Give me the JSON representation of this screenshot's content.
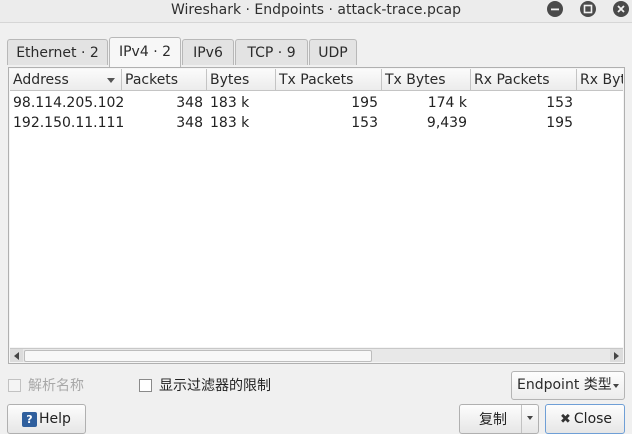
{
  "window": {
    "title": "Wireshark · Endpoints · attack-trace.pcap",
    "controls": [
      "minimize-icon",
      "maximize-icon",
      "close-icon"
    ]
  },
  "tabs": [
    {
      "label": "Ethernet · 2",
      "active": false
    },
    {
      "label": "IPv4 · 2",
      "active": true
    },
    {
      "label": "IPv6",
      "active": false
    },
    {
      "label": "TCP · 9",
      "active": false
    },
    {
      "label": "UDP",
      "active": false
    }
  ],
  "table": {
    "columns": [
      "Address",
      "Packets",
      "Bytes",
      "Tx Packets",
      "Tx Bytes",
      "Rx Packets",
      "Rx Byte"
    ],
    "sort_column": "Address",
    "rows": [
      [
        "98.114.205.102",
        "348",
        "183 k",
        "195",
        "174 k",
        "153",
        ""
      ],
      [
        "192.150.11.111",
        "348",
        "183 k",
        "153",
        "9,439",
        "195",
        ""
      ]
    ]
  },
  "options": {
    "name_resolution": {
      "label": "解析名称",
      "checked": false,
      "enabled": false
    },
    "limit_to_filter": {
      "label": "显示过滤器的限制",
      "checked": false,
      "enabled": true
    }
  },
  "endpoint_type": {
    "label": "Endpoint 类型"
  },
  "buttons": {
    "help": "Help",
    "copy": "复制",
    "close": "Close"
  },
  "colors": {
    "window_bg": "#f0f0f0",
    "title_button": "#4a4a4a",
    "help_icon": "#2f5f9d"
  }
}
